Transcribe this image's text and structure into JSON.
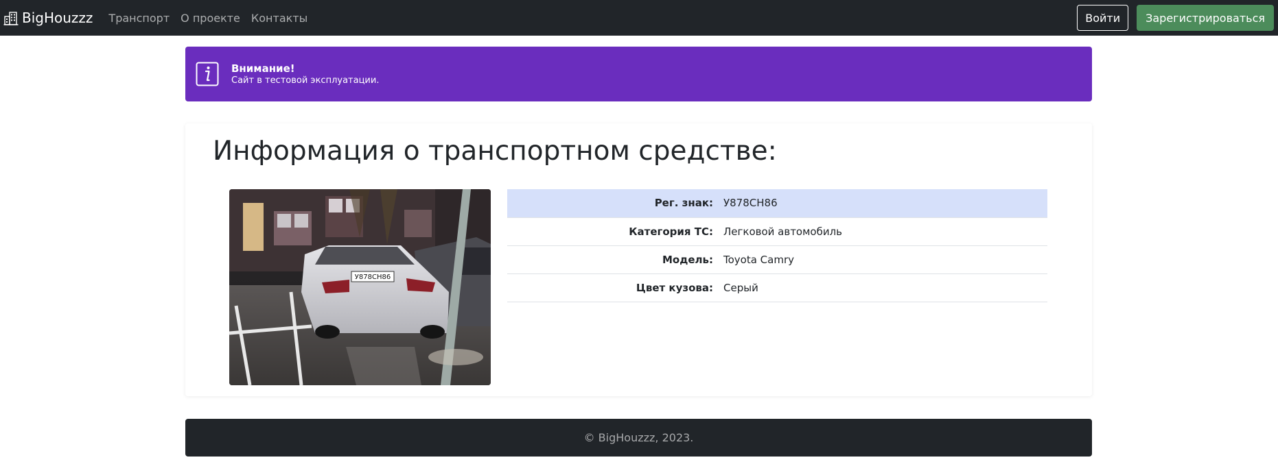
{
  "navbar": {
    "brand": "BigHouzzz",
    "brand_icon": "buildings-icon",
    "links": [
      "Транспорт",
      "О проекте",
      "Контакты"
    ],
    "login_label": "Войти",
    "register_label": "Зарегистрироваться"
  },
  "alert": {
    "icon": "info-icon",
    "title": "Внимание!",
    "text": "Сайт в тестовой эксплуатации.",
    "color": "#6a2dbe"
  },
  "vehicle": {
    "title": "Информация о транспортном средстве:",
    "photo_plate_text": "У878СН86",
    "rows": [
      {
        "label": "Рег. знак:",
        "value": "У878СН86"
      },
      {
        "label": "Категория ТС:",
        "value": "Легковой автомобиль"
      },
      {
        "label": "Модель:",
        "value": "Toyota Camry"
      },
      {
        "label": "Цвет кузова:",
        "value": "Серый"
      }
    ]
  },
  "footer": {
    "text": "© BigHouzzz, 2023."
  },
  "colors": {
    "navbar_bg": "#212529",
    "register_button": "#4c8c5b",
    "highlight_row": "#d6e0fa"
  }
}
